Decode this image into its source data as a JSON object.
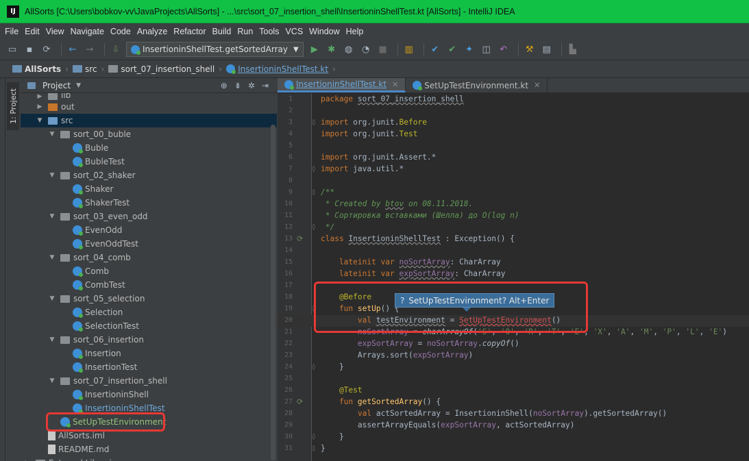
{
  "window": {
    "title": "AllSorts [C:\\Users\\bobkov-vv\\JavaProjects\\AllSorts] - ...\\src\\sort_07_insertion_shell\\InsertioninShellTest.kt [AllSorts] - IntelliJ IDEA",
    "app_icon": "IJ"
  },
  "menu": [
    "File",
    "Edit",
    "View",
    "Navigate",
    "Code",
    "Analyze",
    "Refactor",
    "Build",
    "Run",
    "Tools",
    "VCS",
    "Window",
    "Help"
  ],
  "toolbar": {
    "run_config": "InsertioninShellTest.getSortedArray"
  },
  "breadcrumbs": [
    "AllSorts",
    "src",
    "sort_07_insertion_shell",
    "InsertioninShellTest.kt"
  ],
  "side_tab": "1: Project",
  "project_panel": {
    "title": "Project",
    "tree": [
      {
        "label": "lib",
        "level": 1,
        "type": "folder",
        "arrow": "right",
        "partial": true
      },
      {
        "label": "out",
        "level": 1,
        "type": "folder-orange",
        "arrow": "right"
      },
      {
        "label": "src",
        "level": 1,
        "type": "folder-blue",
        "arrow": "down",
        "selected": true
      },
      {
        "label": "sort_00_buble",
        "level": 2,
        "type": "package",
        "arrow": "down"
      },
      {
        "label": "Buble",
        "level": 3,
        "type": "kt"
      },
      {
        "label": "BubleTest",
        "level": 3,
        "type": "kt"
      },
      {
        "label": "sort_02_shaker",
        "level": 2,
        "type": "package",
        "arrow": "down"
      },
      {
        "label": "Shaker",
        "level": 3,
        "type": "kt"
      },
      {
        "label": "ShakerTest",
        "level": 3,
        "type": "kt"
      },
      {
        "label": "sort_03_even_odd",
        "level": 2,
        "type": "package",
        "arrow": "down"
      },
      {
        "label": "EvenOdd",
        "level": 3,
        "type": "kt"
      },
      {
        "label": "EvenOddTest",
        "level": 3,
        "type": "kt"
      },
      {
        "label": "sort_04_comb",
        "level": 2,
        "type": "package",
        "arrow": "down"
      },
      {
        "label": "Comb",
        "level": 3,
        "type": "kt"
      },
      {
        "label": "CombTest",
        "level": 3,
        "type": "kt"
      },
      {
        "label": "sort_05_selection",
        "level": 2,
        "type": "package",
        "arrow": "down"
      },
      {
        "label": "Selection",
        "level": 3,
        "type": "kt"
      },
      {
        "label": "SelectionTest",
        "level": 3,
        "type": "kt"
      },
      {
        "label": "sort_06_insertion",
        "level": 2,
        "type": "package",
        "arrow": "down"
      },
      {
        "label": "Insertion",
        "level": 3,
        "type": "kt"
      },
      {
        "label": "InsertionTest",
        "level": 3,
        "type": "kt"
      },
      {
        "label": "sort_07_insertion_shell",
        "level": 2,
        "type": "package",
        "arrow": "down"
      },
      {
        "label": "InsertioninShell",
        "level": 3,
        "type": "kt"
      },
      {
        "label": "InsertioninShellTest",
        "level": 3,
        "type": "kt",
        "highlight": true
      },
      {
        "label": "SetUpTestEnvironment",
        "level": 2,
        "type": "kt",
        "green": true,
        "boxed": true
      },
      {
        "label": "AllSorts.iml",
        "level": 1,
        "type": "doc"
      },
      {
        "label": "README.md",
        "level": 1,
        "type": "doc"
      },
      {
        "label": "External Libraries",
        "level": 0,
        "type": "folder",
        "arrow": "right",
        "partial": true
      }
    ]
  },
  "editor": {
    "tabs": [
      {
        "label": "InsertioninShellTest.kt",
        "active": true
      },
      {
        "label": "SetUpTestEnvironment.kt",
        "active": false
      }
    ],
    "hint": "SetUpTestEnvironment? Alt+Enter",
    "hint_icon": "?",
    "lines": [
      {
        "n": "1",
        "tokens": [
          [
            "kw",
            "package "
          ],
          [
            "und",
            "sort_07_insertion_shell"
          ]
        ]
      },
      {
        "n": "2",
        "tokens": []
      },
      {
        "n": "3",
        "tokens": [
          [
            "kw",
            "import "
          ],
          [
            "",
            "org.junit."
          ],
          [
            "ann",
            "Before"
          ]
        ],
        "fold": true
      },
      {
        "n": "4",
        "tokens": [
          [
            "kw",
            "import "
          ],
          [
            "",
            "org.junit."
          ],
          [
            "ann",
            "Test"
          ]
        ]
      },
      {
        "n": "5",
        "tokens": []
      },
      {
        "n": "6",
        "tokens": [
          [
            "kw",
            "import "
          ],
          [
            "",
            "org.junit.Assert.*"
          ]
        ]
      },
      {
        "n": "7",
        "tokens": [
          [
            "kw",
            "import "
          ],
          [
            "",
            "java.util.*"
          ]
        ],
        "fold": true
      },
      {
        "n": "8",
        "tokens": []
      },
      {
        "n": "9",
        "tokens": [
          [
            "cm",
            "/**"
          ]
        ],
        "fold": true
      },
      {
        "n": "10",
        "tokens": [
          [
            "cm",
            " * Created by "
          ],
          [
            "cm und",
            "btov"
          ],
          [
            "cm",
            " on 08.11.2018."
          ]
        ]
      },
      {
        "n": "11",
        "tokens": [
          [
            "cm",
            " * Сортировка вставками (Шелла) до O(log n)"
          ]
        ]
      },
      {
        "n": "12",
        "tokens": [
          [
            "cm",
            " */"
          ]
        ],
        "fold": true
      },
      {
        "n": "13",
        "tokens": [
          [
            "kw",
            "class "
          ],
          [
            "und",
            "InsertioninShellTest"
          ],
          [
            "",
            " : Exception() {"
          ]
        ],
        "run": true
      },
      {
        "n": "14",
        "tokens": []
      },
      {
        "n": "15",
        "tokens": [
          [
            "kw",
            "    lateinit var "
          ],
          [
            "prop und",
            "noSortArray"
          ],
          [
            "",
            ": CharArray"
          ]
        ]
      },
      {
        "n": "16",
        "tokens": [
          [
            "kw",
            "    lateinit var "
          ],
          [
            "prop und",
            "expSortArray"
          ],
          [
            "",
            ": CharArray"
          ]
        ]
      },
      {
        "n": "17",
        "tokens": []
      },
      {
        "n": "18",
        "tokens": [
          [
            "ann",
            "    @Before"
          ]
        ]
      },
      {
        "n": "19",
        "tokens": [
          [
            "kw",
            "    fun "
          ],
          [
            "fnm",
            "setUp"
          ],
          [
            "",
            "() {"
          ]
        ],
        "fold": true
      },
      {
        "n": "20",
        "tokens": [
          [
            "kw",
            "        val "
          ],
          [
            "und",
            "testEnvironment"
          ],
          [
            "",
            " = "
          ],
          [
            "err",
            "SetUpTestEnvironment"
          ],
          [
            "",
            "()"
          ]
        ],
        "current": true
      },
      {
        "n": "21",
        "tokens": [
          [
            "prop",
            "        noSortArray"
          ],
          [
            "",
            " = "
          ],
          [
            "it",
            "charArrayOf"
          ],
          [
            "",
            "("
          ],
          [
            "str",
            "'S'"
          ],
          [
            "",
            ", "
          ],
          [
            "str",
            "'O'"
          ],
          [
            "",
            ", "
          ],
          [
            "str",
            "'R'"
          ],
          [
            "",
            ", "
          ],
          [
            "str",
            "'T'"
          ],
          [
            "",
            ", "
          ],
          [
            "str",
            "'E'"
          ],
          [
            "",
            ", "
          ],
          [
            "str",
            "'X'"
          ],
          [
            "",
            ", "
          ],
          [
            "str",
            "'A'"
          ],
          [
            "",
            ", "
          ],
          [
            "str",
            "'M'"
          ],
          [
            "",
            ", "
          ],
          [
            "str",
            "'P'"
          ],
          [
            "",
            ", "
          ],
          [
            "str",
            "'L'"
          ],
          [
            "",
            ", "
          ],
          [
            "str",
            "'E'"
          ],
          [
            "",
            ")"
          ]
        ]
      },
      {
        "n": "22",
        "tokens": [
          [
            "prop",
            "        expSortArray"
          ],
          [
            "",
            " = "
          ],
          [
            "prop",
            "noSortArray"
          ],
          [
            "",
            "."
          ],
          [
            "it",
            "copyOf"
          ],
          [
            "",
            "()"
          ]
        ]
      },
      {
        "n": "23",
        "tokens": [
          [
            "",
            "        Arrays.sort("
          ],
          [
            "prop",
            "expSortArray"
          ],
          [
            "",
            ")"
          ]
        ]
      },
      {
        "n": "24",
        "tokens": [
          [
            "",
            "    }"
          ]
        ],
        "fold": true
      },
      {
        "n": "25",
        "tokens": []
      },
      {
        "n": "26",
        "tokens": [
          [
            "ann",
            "    @Test"
          ]
        ]
      },
      {
        "n": "27",
        "tokens": [
          [
            "kw",
            "    fun "
          ],
          [
            "fnm",
            "getSortedArray"
          ],
          [
            "",
            "() {"
          ]
        ],
        "run": true
      },
      {
        "n": "28",
        "tokens": [
          [
            "kw",
            "        val "
          ],
          [
            "",
            "actSortedArray = InsertioninShell("
          ],
          [
            "prop",
            "noSortArray"
          ],
          [
            "",
            ").getSortedArray()"
          ]
        ]
      },
      {
        "n": "29",
        "tokens": [
          [
            "",
            "        assertArrayEquals("
          ],
          [
            "prop",
            "expSortArray"
          ],
          [
            "",
            ", actSortedArray)"
          ]
        ]
      },
      {
        "n": "30",
        "tokens": [
          [
            "",
            "    }"
          ]
        ],
        "fold": true
      },
      {
        "n": "31",
        "tokens": [
          [
            "",
            "}"
          ]
        ],
        "fold": true
      }
    ]
  }
}
